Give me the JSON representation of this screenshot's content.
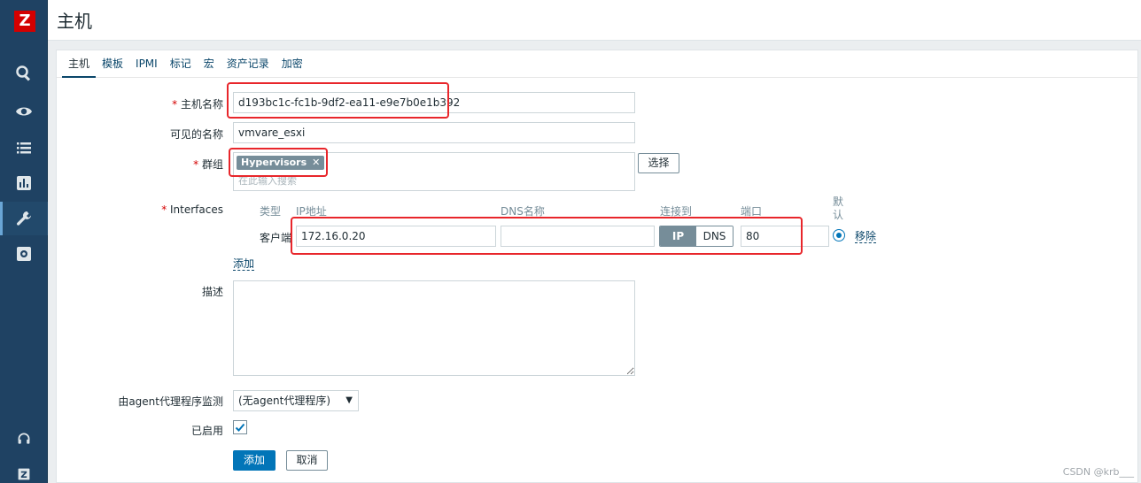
{
  "header": {
    "title": "主机"
  },
  "sidebar": {
    "logo": "Z",
    "icons": [
      "search-icon",
      "eye-icon",
      "list-icon",
      "chart-icon",
      "wrench-icon",
      "gear-icon",
      "headset-icon",
      "zabbix-icon"
    ]
  },
  "tabs": [
    "主机",
    "模板",
    "IPMI",
    "标记",
    "宏",
    "资产记录",
    "加密"
  ],
  "form": {
    "hostname_label": "主机名称",
    "hostname_value": "d193bc1c-fc1b-9df2-ea11-e9e7b0e1b392",
    "visible_name_label": "可见的名称",
    "visible_name_value": "vmvare_esxi",
    "groups_label": "群组",
    "group_tag": "Hypervisors",
    "group_tag_remove": "✕",
    "groups_placeholder": "在此输入搜索",
    "select_button": "选择",
    "interfaces_label": "Interfaces",
    "interface_headers": {
      "type": "类型",
      "ip": "IP地址",
      "dns": "DNS名称",
      "connect": "连接到",
      "port": "端口",
      "default": "默认"
    },
    "interface_row": {
      "type": "客户端",
      "ip": "172.16.0.20",
      "dns": "",
      "connect_ip": "IP",
      "connect_dns": "DNS",
      "port": "80",
      "remove": "移除"
    },
    "add_interface": "添加",
    "description_label": "描述",
    "description_value": "",
    "proxy_label": "由agent代理程序监测",
    "proxy_value": "(无agent代理程序)",
    "enabled_label": "已启用",
    "add_button": "添加",
    "cancel_button": "取消"
  },
  "watermark": "CSDN @krb___",
  "colors": {
    "highlight": "#e8262b",
    "accent": "#0275b8",
    "sidebar": "#1f4263"
  }
}
